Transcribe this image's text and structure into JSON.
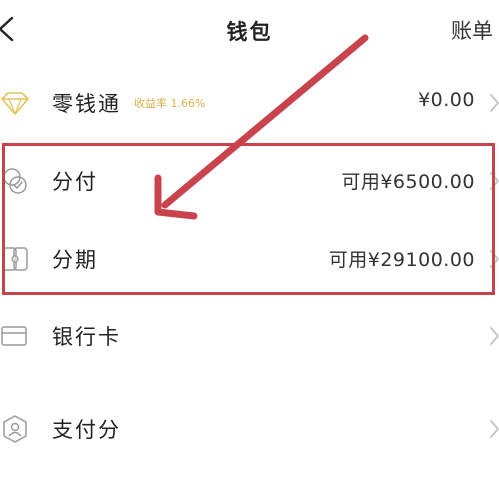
{
  "header": {
    "title": "钱包",
    "right_link": "账单"
  },
  "rows": [
    {
      "label": "零钱通",
      "sub": "收益率 1.66%",
      "value": "¥0.00",
      "icon": "diamond-icon"
    },
    {
      "label": "分付",
      "value": "可用¥6500.00",
      "icon": "fenfu-icon"
    },
    {
      "label": "分期",
      "value": "可用¥29100.00",
      "icon": "installment-icon"
    },
    {
      "label": "银行卡",
      "value": "",
      "icon": "bank-card-icon"
    },
    {
      "label": "支付分",
      "value": "",
      "icon": "pay-score-icon"
    }
  ],
  "colors": {
    "annotation_red": "#c8434c",
    "yield_gold": "#d8b24a",
    "icon_gray": "#9a9a9a"
  }
}
